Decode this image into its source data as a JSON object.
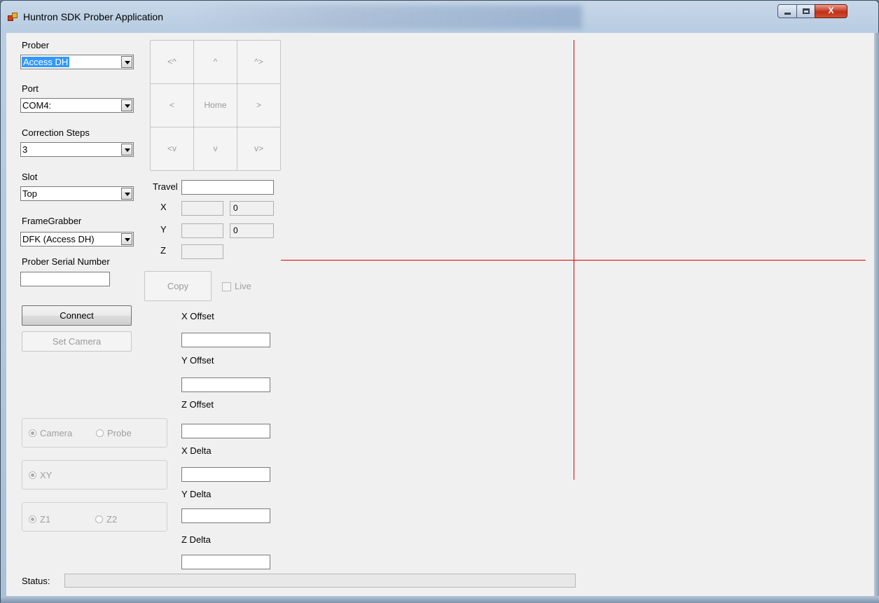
{
  "window": {
    "title": "Huntron SDK Prober Application",
    "accent_color": "#3399ff",
    "crosshair_color": "#e00000"
  },
  "caption_buttons": {
    "close_glyph": "X"
  },
  "left": {
    "prober": {
      "label": "Prober",
      "value": "Access DH"
    },
    "port": {
      "label": "Port",
      "value": "COM4:"
    },
    "correction_steps": {
      "label": "Correction Steps",
      "value": "3"
    },
    "slot": {
      "label": "Slot",
      "value": "Top"
    },
    "framegrabber": {
      "label": "FrameGrabber",
      "value": "DFK (Access DH)"
    },
    "serial": {
      "label": "Prober Serial Number",
      "value": ""
    },
    "connect_label": "Connect",
    "set_camera_label": "Set Camera"
  },
  "pad": {
    "up_left": "<^",
    "up": "^",
    "up_right": "^>",
    "left": "<",
    "home": "Home",
    "right": ">",
    "down_left": "<v",
    "down": "v",
    "down_right": "v>"
  },
  "position": {
    "travel_label": "Travel",
    "travel_value": "",
    "x_label": "X",
    "x_value": "",
    "x_readout": "0",
    "y_label": "Y",
    "y_value": "",
    "y_readout": "0",
    "z_label": "Z",
    "z_value": "",
    "copy_label": "Copy",
    "live_label": "Live",
    "live_checked": false
  },
  "offsets": {
    "x_offset_label": "X Offset",
    "y_offset_label": "Y Offset",
    "z_offset_label": "Z Offset",
    "x_delta_label": "X Delta",
    "y_delta_label": "Y Delta",
    "z_delta_label": "Z Delta"
  },
  "groups": {
    "camera_label": "Camera",
    "probe_label": "Probe",
    "xy_label": "XY",
    "z1_label": "Z1",
    "z2_label": "Z2",
    "selected_mode": "Camera",
    "selected_axis": "XY",
    "selected_z": "Z1"
  },
  "status": {
    "label": "Status:",
    "text": ""
  }
}
